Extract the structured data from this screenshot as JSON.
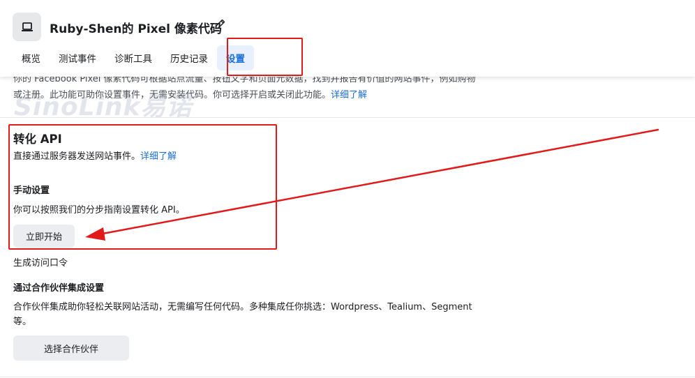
{
  "header": {
    "title": "Ruby-Shen的 Pixel 像素代码",
    "pixel_icon": "laptop-icon",
    "edit_icon": "pencil-icon",
    "tabs": [
      {
        "label": "概览"
      },
      {
        "label": "测试事件"
      },
      {
        "label": "诊断工具"
      },
      {
        "label": "历史记录"
      },
      {
        "label": "设置",
        "active": true
      }
    ]
  },
  "top_section": {
    "line1": "你的 Facebook Pixel 像素代码可根据站点流量、按钮文字和页面元数据，找到并报告有价值的网站事件，例如购物",
    "line2": "或注册。此功能可助你设置事件，无需安装代码。你可选择开启或关闭此功能。",
    "learn_more": "详细了解"
  },
  "watermark": "SinoLink易诺",
  "conversion_api": {
    "title": "转化 API",
    "description": "直接通过服务器发送网站事件。",
    "learn_more": "详细了解",
    "manual_setup_title": "手动设置",
    "manual_setup_text": "你可以按照我们的分步指南设置转化 API。",
    "start_button": "立即开始",
    "access_token_link": "生成访问口令"
  },
  "partner": {
    "title": "通过合作伙伴集成设置",
    "line1": "合作伙伴集成助你轻松关联网站活动，无需编写任何代码。多种集成任你挑选：Wordpress、Tealium、Segment",
    "line2": "等。",
    "button": "选择合作伙伴"
  },
  "colors": {
    "accent": "#1a6ed8",
    "annotation": "#e21a1a",
    "button_bg": "#ebedf0",
    "active_tab_bg": "#e7f0fc"
  }
}
